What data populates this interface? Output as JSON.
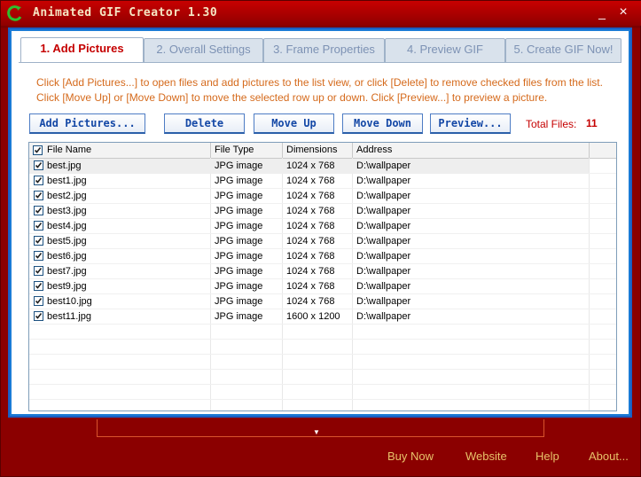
{
  "window": {
    "title": "Animated GIF Creator 1.30",
    "minimize": "_",
    "close": "×"
  },
  "tabs": [
    {
      "label": "1. Add Pictures",
      "active": true
    },
    {
      "label": "2. Overall Settings",
      "active": false
    },
    {
      "label": "3. Frame Properties",
      "active": false
    },
    {
      "label": "4. Preview GIF",
      "active": false
    },
    {
      "label": "5. Create GIF Now!",
      "active": false
    }
  ],
  "instructions": {
    "line1": "Click [Add Pictures...] to open files and add pictures to the list view, or click [Delete] to remove checked files from the list.",
    "line2": "Click [Move Up] or [Move Down] to move the selected row up or down. Click [Preview...] to preview a picture."
  },
  "toolbar": {
    "add_pictures": "Add Pictures...",
    "delete": "Delete",
    "move_up": "Move Up",
    "move_down": "Move Down",
    "preview": "Preview...",
    "total_label": "Total Files:",
    "total_count": "11"
  },
  "list": {
    "columns": [
      "File Name",
      "File Type",
      "Dimensions",
      "Address"
    ],
    "header_checked": true,
    "rows": [
      {
        "name": "best.jpg",
        "type": "JPG image",
        "dims": "1024 x 768",
        "addr": "D:\\wallpaper",
        "checked": true
      },
      {
        "name": "best1.jpg",
        "type": "JPG image",
        "dims": "1024 x 768",
        "addr": "D:\\wallpaper",
        "checked": true
      },
      {
        "name": "best2.jpg",
        "type": "JPG image",
        "dims": "1024 x 768",
        "addr": "D:\\wallpaper",
        "checked": true
      },
      {
        "name": "best3.jpg",
        "type": "JPG image",
        "dims": "1024 x 768",
        "addr": "D:\\wallpaper",
        "checked": true
      },
      {
        "name": "best4.jpg",
        "type": "JPG image",
        "dims": "1024 x 768",
        "addr": "D:\\wallpaper",
        "checked": true
      },
      {
        "name": "best5.jpg",
        "type": "JPG image",
        "dims": "1024 x 768",
        "addr": "D:\\wallpaper",
        "checked": true
      },
      {
        "name": "best6.jpg",
        "type": "JPG image",
        "dims": "1024 x 768",
        "addr": "D:\\wallpaper",
        "checked": true
      },
      {
        "name": "best7.jpg",
        "type": "JPG image",
        "dims": "1024 x 768",
        "addr": "D:\\wallpaper",
        "checked": true
      },
      {
        "name": "best9.jpg",
        "type": "JPG image",
        "dims": "1024 x 768",
        "addr": "D:\\wallpaper",
        "checked": true
      },
      {
        "name": "best10.jpg",
        "type": "JPG image",
        "dims": "1024 x 768",
        "addr": "D:\\wallpaper",
        "checked": true
      },
      {
        "name": "best11.jpg",
        "type": "JPG image",
        "dims": "1600 x 1200",
        "addr": "D:\\wallpaper",
        "checked": true
      }
    ]
  },
  "footer": {
    "buy_now": "Buy Now",
    "website": "Website",
    "help": "Help",
    "about": "About..."
  },
  "colors": {
    "frame": "#8b0000",
    "panel_border": "#1b7bd6",
    "accent_text": "#c50000",
    "instruction_text": "#d56a1c",
    "button_text": "#1448a6",
    "footer_link": "#e8c26a"
  },
  "icons": [
    "app-logo-icon",
    "checkbox-icon",
    "expand-arrow-icon"
  ]
}
